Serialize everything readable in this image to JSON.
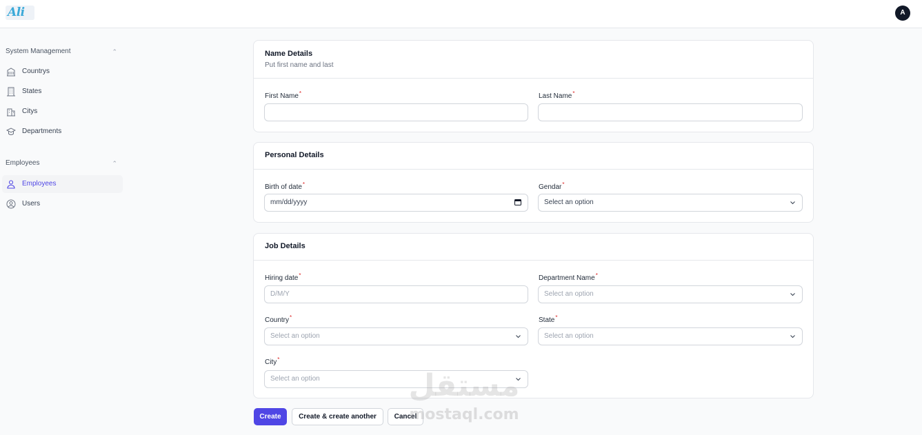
{
  "app": {
    "logo_text": "Ali",
    "avatar_initial": "A"
  },
  "sidebar": {
    "groups": [
      {
        "label": "System Management",
        "items": [
          {
            "label": "Countrys",
            "icon": "building-icon"
          },
          {
            "label": "States",
            "icon": "office-building-icon"
          },
          {
            "label": "Citys",
            "icon": "city-icon"
          },
          {
            "label": "Departments",
            "icon": "academic-cap-icon"
          }
        ]
      },
      {
        "label": "Employees",
        "items": [
          {
            "label": "Employees",
            "icon": "user-icon",
            "active": true
          },
          {
            "label": "Users",
            "icon": "user-circle-icon"
          }
        ]
      }
    ]
  },
  "form": {
    "required_marker": "*",
    "name_details": {
      "title": "Name Details",
      "subtitle": "Put first name and last",
      "first_name": {
        "label": "First Name",
        "value": ""
      },
      "last_name": {
        "label": "Last Name",
        "value": ""
      }
    },
    "personal_details": {
      "title": "Personal Details",
      "birth_date": {
        "label": "Birth of date",
        "placeholder": "mm/dd/yyyy"
      },
      "gender": {
        "label": "Gendar",
        "placeholder": "Select an option"
      }
    },
    "job_details": {
      "title": "Job Details",
      "hiring_date": {
        "label": "Hiring date",
        "placeholder": "D/M/Y"
      },
      "department": {
        "label": "Department Name",
        "placeholder": "Select an option"
      },
      "country": {
        "label": "Country",
        "placeholder": "Select an option"
      },
      "state": {
        "label": "State",
        "placeholder": "Select an option"
      },
      "city": {
        "label": "City",
        "placeholder": "Select an option"
      }
    }
  },
  "actions": {
    "create": "Create",
    "create_another": "Create & create another",
    "cancel": "Cancel"
  },
  "watermark": {
    "arabic": "مستقل",
    "latin": "mostaql.com"
  },
  "colors": {
    "accent": "#4f46e5",
    "required": "#dc2626",
    "logo": "#3aa9d8"
  }
}
